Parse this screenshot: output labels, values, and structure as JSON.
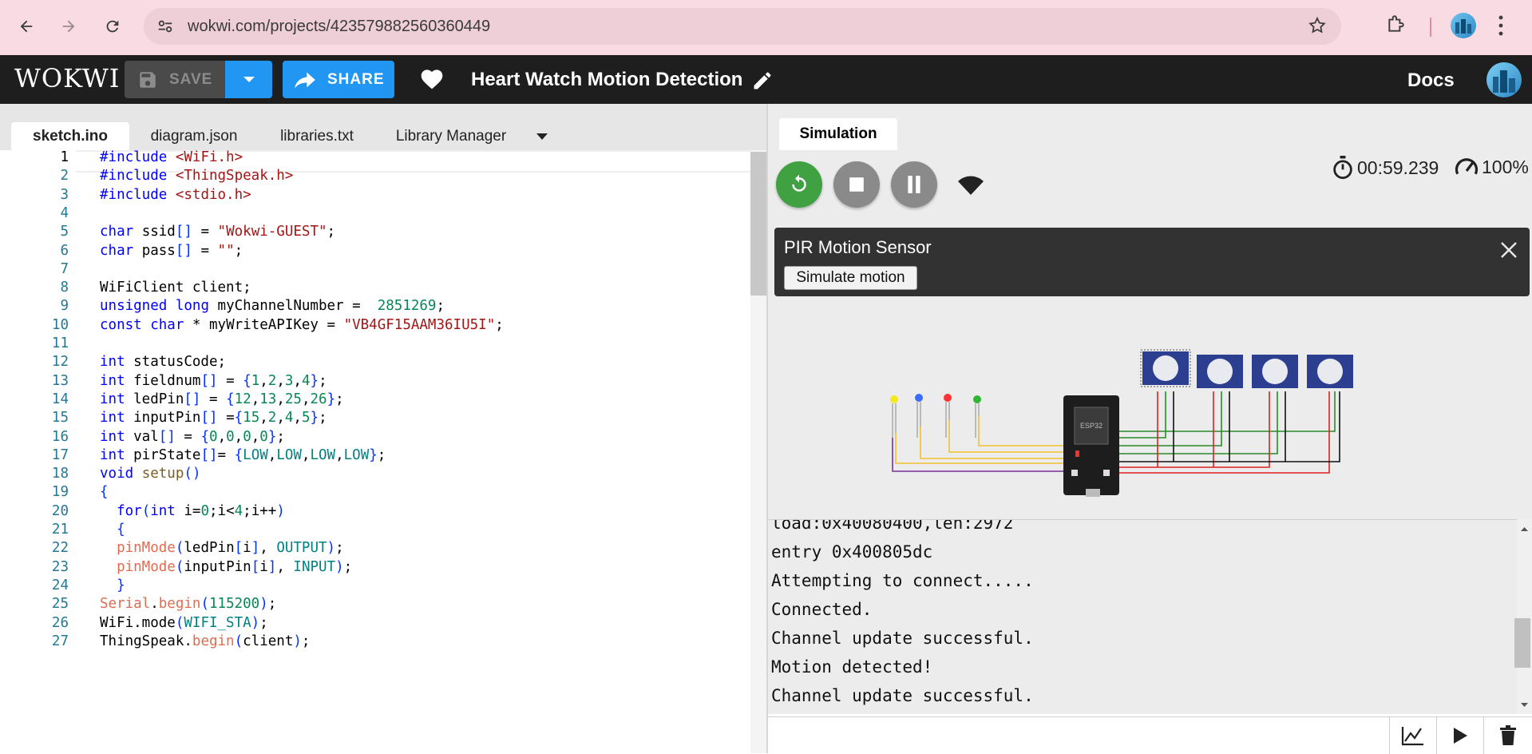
{
  "browser": {
    "url": "wokwi.com/projects/423579882560360449"
  },
  "header": {
    "logo": "WOKWI",
    "save_label": "SAVE",
    "share_label": "SHARE",
    "project_title": "Heart Watch Motion Detection",
    "docs_label": "Docs"
  },
  "editor": {
    "tabs": [
      "sketch.ino",
      "diagram.json",
      "libraries.txt",
      "Library Manager"
    ],
    "active_tab": "sketch.ino",
    "lines": [
      "#include <WiFi.h>",
      "#include <ThingSpeak.h>",
      "#include <stdio.h>",
      "",
      "char ssid[] = \"Wokwi-GUEST\";",
      "char pass[] = \"\";",
      "",
      "WiFiClient client;",
      "unsigned long myChannelNumber =  2851269;",
      "const char * myWriteAPIKey = \"VB4GF15AAM36IU5I\";",
      "",
      "int statusCode;",
      "int fieldnum[] = {1,2,3,4};",
      "int ledPin[] = {12,13,25,26};",
      "int inputPin[] ={15,2,4,5};",
      "int val[] = {0,0,0,0};",
      "int pirState[]= {LOW,LOW,LOW,LOW};",
      "void setup()",
      "{",
      "  for(int i=0;i<4;i++)",
      "  {",
      "  pinMode(ledPin[i], OUTPUT);",
      "  pinMode(inputPin[i], INPUT);",
      "  }",
      "Serial.begin(115200);",
      "WiFi.mode(WIFI_STA);",
      "ThingSpeak.begin(client);"
    ]
  },
  "simulation": {
    "tab_label": "Simulation",
    "timer": "00:59.239",
    "speed": "100%",
    "pir_popup": {
      "title": "PIR Motion Sensor",
      "button_label": "Simulate motion"
    },
    "chip_label": "ESP32",
    "led_colors": [
      "#f4e81f",
      "#3d6bff",
      "#ff3333",
      "#2fb52f"
    ]
  },
  "serial": {
    "lines": [
      "load:0x40080400,len:2972",
      "entry 0x400805dc",
      "Attempting to connect.....",
      "Connected.",
      "Channel update successful.",
      "Motion detected!",
      "Channel update successful."
    ]
  }
}
